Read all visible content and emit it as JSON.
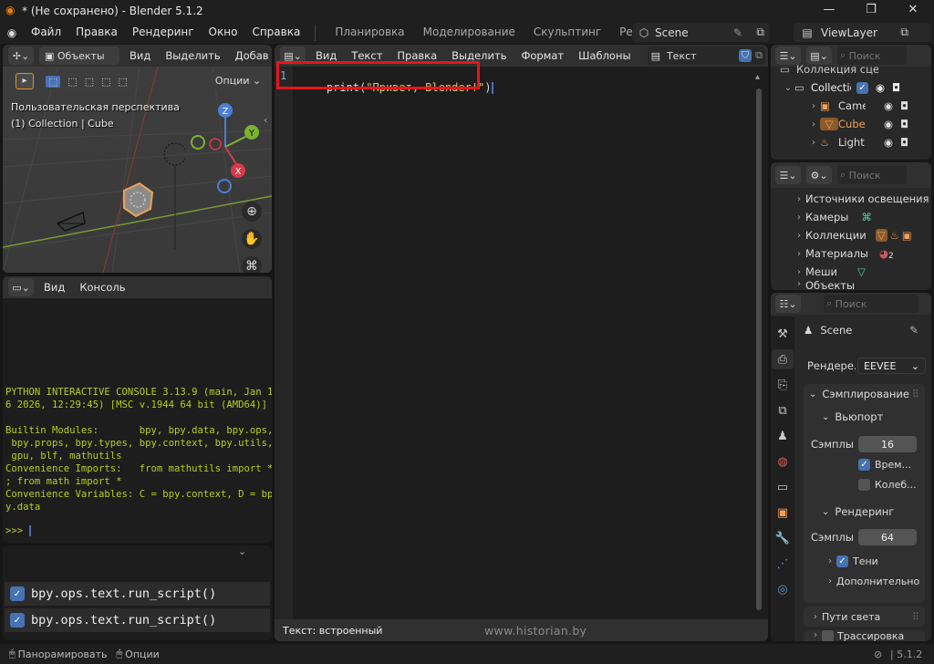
{
  "window": {
    "title": "* (Не сохранено) - Blender 5.1.2",
    "minimize": "—",
    "maximize": "❐",
    "close": "✕"
  },
  "menu": [
    "Файл",
    "Правка",
    "Рендеринг",
    "Окно",
    "Справка"
  ],
  "workspaces": [
    "Планировка",
    "Моделирование",
    "Скульптинг",
    "Редактирование"
  ],
  "scene_selector": "Scene",
  "viewlayer_selector": "ViewLayer",
  "viewport": {
    "mode": "Объекты",
    "menu": [
      "Вид",
      "Выделить",
      "Добавить"
    ],
    "options": "Опции",
    "overlay_line1": "Пользовательская перспектива",
    "overlay_line2": "(1) Collection | Cube",
    "gizmo": {
      "x": "X",
      "y": "Y",
      "z": "Z"
    }
  },
  "console": {
    "menu": [
      "Вид",
      "Консоль"
    ],
    "lines": [
      "PYTHON INTERACTIVE CONSOLE 3.13.9 (main, Jan 1",
      "6 2026, 12:29:45) [MSC v.1944 64 bit (AMD64)]",
      "",
      "Builtin Modules:       bpy, bpy.data, bpy.ops,",
      " bpy.props, bpy.types, bpy.context, bpy.utils,",
      " gpu, blf, mathutils",
      "Convenience Imports:   from mathutils import *",
      "; from math import *",
      "Convenience Variables: C = bpy.context, D = bp",
      "y.data"
    ],
    "prompt": ">>>"
  },
  "info_log": {
    "entries": [
      "bpy.ops.text.run_script()",
      "bpy.ops.text.run_script()"
    ]
  },
  "text_editor": {
    "menu": [
      "Вид",
      "Текст",
      "Правка",
      "Выделить",
      "Формат",
      "Шаблоны"
    ],
    "datablock": "Текст",
    "line_number": "1",
    "code_func": "print(",
    "code_string": "\"Привет, Blender!\"",
    "code_close": ")",
    "footer_status": "Текст: встроенный",
    "watermark": "www.historian.by"
  },
  "outliner": {
    "search_placeholder": "Поиск",
    "rows": [
      {
        "label": "Коллекция сцены"
      },
      {
        "label": "Collection"
      },
      {
        "label": "Camera"
      },
      {
        "label": "Cube"
      },
      {
        "label": "Light"
      }
    ]
  },
  "data_browser": {
    "search_placeholder": "Поиск",
    "rows": [
      "Источники освещения",
      "Камеры",
      "Коллекции",
      "Материалы",
      "Меши",
      "Объекты"
    ],
    "materials_count": "2"
  },
  "properties": {
    "search_placeholder": "Поиск",
    "scene_name": "Scene",
    "render_engine_label": "Рендере...",
    "render_engine_value": "EEVEE",
    "sampling_header": "Сэмплирование",
    "viewport_header": "Вьюпорт",
    "viewport_samples_label": "Сэмплы",
    "viewport_samples_value": "16",
    "temporal_label": "Врем...",
    "jitter_label": "Колеб...",
    "render_header": "Рендеринг",
    "render_samples_label": "Сэмплы",
    "render_samples_value": "64",
    "shadows_label": "Тени",
    "advanced_label": "Дополнительно",
    "light_paths_label": "Пути света",
    "raytracing_label": "Трассировка"
  },
  "statusbar": {
    "pan": "Панорамировать",
    "options": "Опции",
    "version": "5.1.2"
  },
  "colors": {
    "accent_blue": "#4772b3",
    "highlight_red": "#e8141c",
    "console_text": "#b4d01f",
    "active_object": "#f0a15a",
    "string_yellow": "#d8c56a"
  }
}
